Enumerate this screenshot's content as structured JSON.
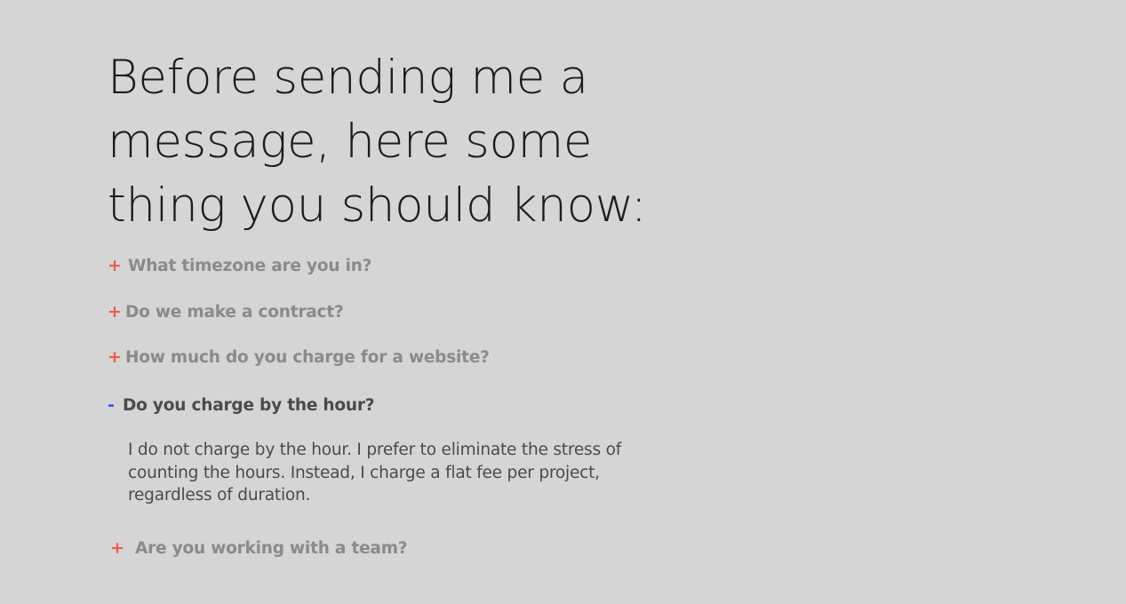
{
  "intro": {
    "heading": "Before sending  me a\nmessage, here some\nthing you should know:"
  },
  "faq": {
    "items": [
      {
        "toggle": "+",
        "question": "What timezone are you in?"
      },
      {
        "toggle": "+",
        "question": "Do we make a contract?"
      },
      {
        "toggle": "+",
        "question": "How much do you charge for a website?"
      },
      {
        "toggle": "-",
        "question": "Do you charge by the hour?",
        "answer": "I do not charge by the hour. I prefer to eliminate the stress of counting the hours. Instead, I charge a flat fee per project, regardless of duration."
      },
      {
        "toggle": "+",
        "question": "Are you working with a team?"
      }
    ]
  },
  "colors": {
    "background": "#d5d5d5",
    "plus_accent": "#f05a4a",
    "minus_accent": "#3f4cf0"
  }
}
